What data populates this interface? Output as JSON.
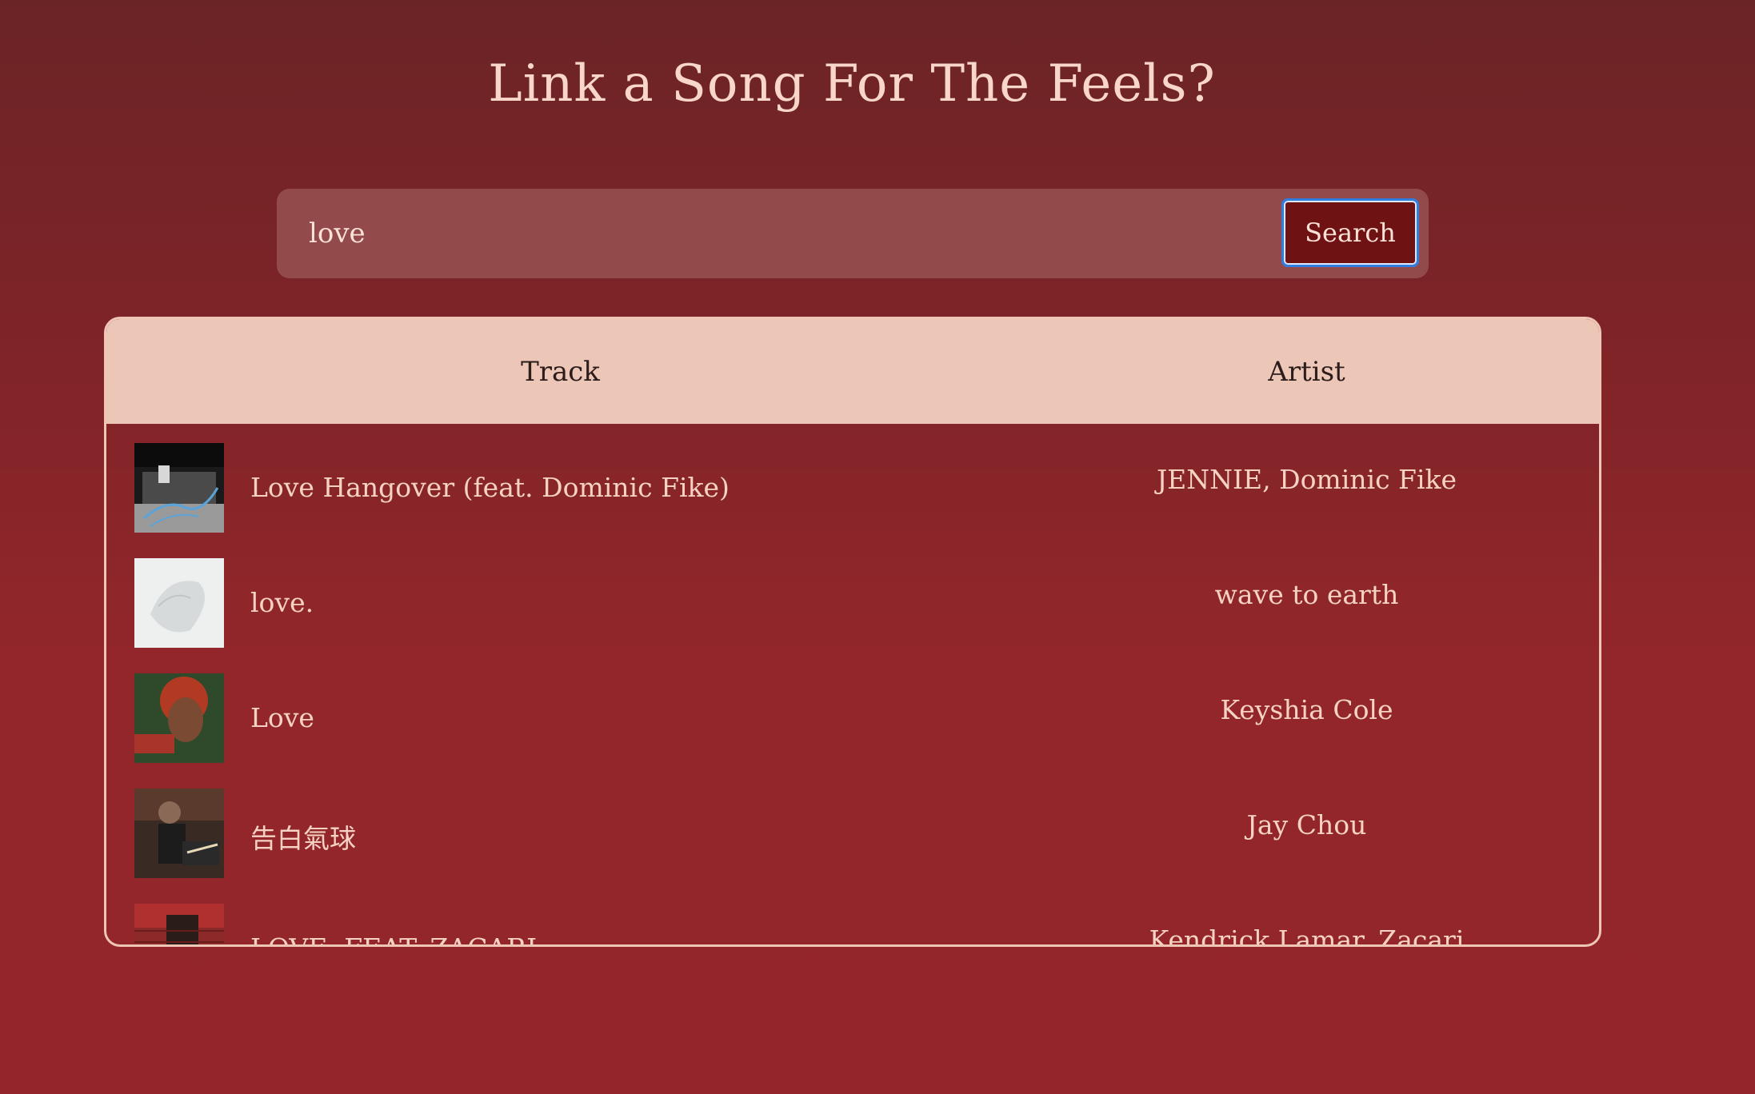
{
  "page": {
    "title": "Link a Song For The Feels?"
  },
  "search": {
    "value": "love",
    "button_label": "Search"
  },
  "table": {
    "headers": {
      "track": "Track",
      "artist": "Artist"
    },
    "rows": [
      {
        "track": "Love Hangover (feat. Dominic Fike)",
        "artist": "JENNIE, Dominic Fike"
      },
      {
        "track": "love.",
        "artist": "wave to earth"
      },
      {
        "track": "Love",
        "artist": "Keyshia Cole"
      },
      {
        "track": "告白氣球",
        "artist": "Jay Chou"
      },
      {
        "track": "LOVE. FEAT. ZACARI.",
        "artist": "Kendrick Lamar, Zacari"
      }
    ]
  },
  "colors": {
    "background_top": "#6b2426",
    "background_bottom": "#94262b",
    "header_bg": "#ecc6b7",
    "search_bg": "#924a4b",
    "button_bg": "#6e1214",
    "button_focus_ring": "#2f7de1",
    "text": "#f6d2c4"
  }
}
